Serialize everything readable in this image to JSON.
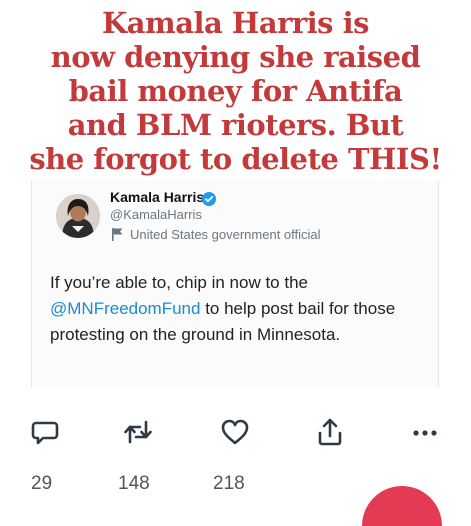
{
  "headline": {
    "lines": [
      "Kamala Harris is",
      "now denying she raised",
      "bail money for Antifa",
      "and BLM rioters. But",
      "she forgot to delete THIS!"
    ]
  },
  "tweet": {
    "author_name": "Kamala Harris",
    "author_handle": "@KamalaHarris",
    "gov_label": "United States government official",
    "body_before": "If you’re able to, chip in now to the",
    "mention": "@MNFreedomFund",
    "body_after": " to help post bail for those protesting on the ground in Minnesota."
  },
  "actions": {
    "reply": {
      "icon": "comment-icon",
      "count": "29"
    },
    "retweet": {
      "icon": "retweet-icon",
      "count": "148"
    },
    "like": {
      "icon": "heart-icon",
      "count": "218"
    },
    "share": {
      "icon": "share-icon"
    },
    "more": {
      "icon": "more-icon"
    }
  },
  "colors": {
    "headline": "#c23a3a",
    "mention": "#1d8bd1",
    "verified": "#1d9bf0",
    "icons": "#2f3a45"
  }
}
